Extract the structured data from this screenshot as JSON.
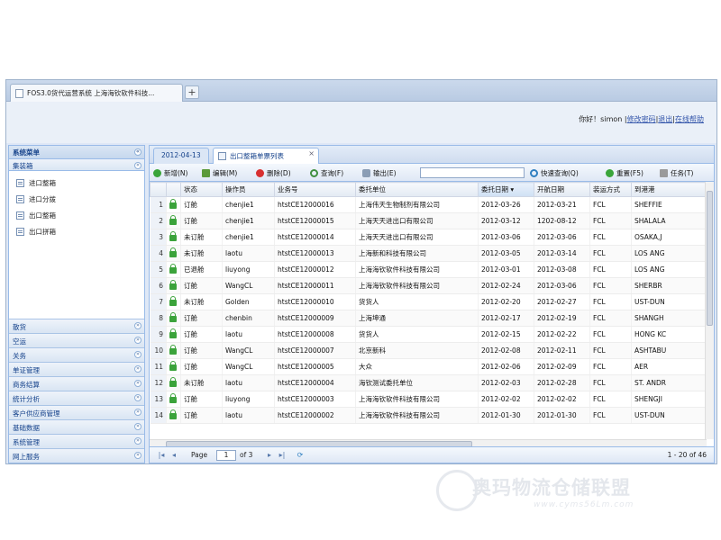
{
  "browser_tab": {
    "title": "FOS3.0货代运营系统 上海海钦软件科技...",
    "add_label": "+"
  },
  "header": {
    "greeting": "你好！simon",
    "link_password": "修改密码",
    "link_logout": "退出",
    "link_help": "在线帮助",
    "separator": "|"
  },
  "sidebar": {
    "title": "系统菜单",
    "section": "集装箱",
    "items": [
      "进口整箱",
      "进口分拨",
      "出口整箱",
      "出口拼箱"
    ],
    "groups": [
      "散货",
      "空运",
      "关务",
      "单证管理",
      "商务结算",
      "统计分析",
      "客户供应商管理",
      "基础数据",
      "系统管理",
      "网上服务"
    ]
  },
  "page_tabs": [
    {
      "label": "2012-04-13"
    },
    {
      "label": "出口整箱单票列表"
    }
  ],
  "toolbar": {
    "add": "新增(N)",
    "edit": "编辑(M)",
    "delete": "删除(D)",
    "query": "查询(F)",
    "export": "输出(E)",
    "search_value": "",
    "quick_query": "快速查询(Q)",
    "reset": "重置(F5)",
    "task": "任务(T)"
  },
  "grid": {
    "columns": [
      "",
      "",
      "状态",
      "操作员",
      "业务号",
      "委托单位",
      "委托日期",
      "开航日期",
      "装运方式",
      "到港港"
    ],
    "sorted_column": "委托日期",
    "rows": [
      {
        "n": "1",
        "status": "订舱",
        "op": "chenjie1",
        "no": "htstCE12000016",
        "client": "上海伟天生物制剂有限公司",
        "entrust": "2012-03-26",
        "sail": "2012-03-21",
        "mode": "FCL",
        "port": "SHEFFIE"
      },
      {
        "n": "2",
        "status": "订舱",
        "op": "chenjie1",
        "no": "htstCE12000015",
        "client": "上海天天进出口有限公司",
        "entrust": "2012-03-12",
        "sail": "1202-08-12",
        "mode": "FCL",
        "port": "SHALALA"
      },
      {
        "n": "3",
        "status": "未订舱",
        "op": "chenjie1",
        "no": "htstCE12000014",
        "client": "上海天天进出口有限公司",
        "entrust": "2012-03-06",
        "sail": "2012-03-06",
        "mode": "FCL",
        "port": "OSAKA,J"
      },
      {
        "n": "4",
        "status": "未订舱",
        "op": "laotu",
        "no": "htstCE12000013",
        "client": "上海新和科技有限公司",
        "entrust": "2012-03-05",
        "sail": "2012-03-14",
        "mode": "FCL",
        "port": "LOS ANG"
      },
      {
        "n": "5",
        "status": "已退舱",
        "op": "liuyong",
        "no": "htstCE12000012",
        "client": "上海海钦软件科技有限公司",
        "entrust": "2012-03-01",
        "sail": "2012-03-08",
        "mode": "FCL",
        "port": "LOS ANG"
      },
      {
        "n": "6",
        "status": "订舱",
        "op": "WangCL",
        "no": "htstCE12000011",
        "client": "上海海钦软件科技有限公司",
        "entrust": "2012-02-24",
        "sail": "2012-03-06",
        "mode": "FCL",
        "port": "SHERBR"
      },
      {
        "n": "7",
        "status": "未订舱",
        "op": "Golden",
        "no": "htstCE12000010",
        "client": "货货人",
        "entrust": "2012-02-20",
        "sail": "2012-02-27",
        "mode": "FCL",
        "port": "UST-DUN"
      },
      {
        "n": "8",
        "status": "订舱",
        "op": "chenbin",
        "no": "htstCE12000009",
        "client": "上海坤通",
        "entrust": "2012-02-17",
        "sail": "2012-02-19",
        "mode": "FCL",
        "port": "SHANGH"
      },
      {
        "n": "9",
        "status": "订舱",
        "op": "laotu",
        "no": "htstCE12000008",
        "client": "货货人",
        "entrust": "2012-02-15",
        "sail": "2012-02-22",
        "mode": "FCL",
        "port": "HONG KC"
      },
      {
        "n": "10",
        "status": "订舱",
        "op": "WangCL",
        "no": "htstCE12000007",
        "client": "北京新科",
        "entrust": "2012-02-08",
        "sail": "2012-02-11",
        "mode": "FCL",
        "port": "ASHTABU"
      },
      {
        "n": "11",
        "status": "订舱",
        "op": "WangCL",
        "no": "htstCE12000005",
        "client": "大众",
        "entrust": "2012-02-06",
        "sail": "2012-02-09",
        "mode": "FCL",
        "port": "AER"
      },
      {
        "n": "12",
        "status": "未订舱",
        "op": "laotu",
        "no": "htstCE12000004",
        "client": "海钦测试委托单位",
        "entrust": "2012-02-03",
        "sail": "2012-02-28",
        "mode": "FCL",
        "port": "ST. ANDR"
      },
      {
        "n": "13",
        "status": "订舱",
        "op": "liuyong",
        "no": "htstCE12000003",
        "client": "上海海钦软件科技有限公司",
        "entrust": "2012-02-02",
        "sail": "2012-02-02",
        "mode": "FCL",
        "port": "SHENGJI"
      },
      {
        "n": "14",
        "status": "订舱",
        "op": "laotu",
        "no": "htstCE12000002",
        "client": "上海海钦软件科技有限公司",
        "entrust": "2012-01-30",
        "sail": "2012-01-30",
        "mode": "FCL",
        "port": "UST-DUN"
      }
    ]
  },
  "pager": {
    "page_label": "Page",
    "page": "1",
    "of_label": "of 3",
    "summary": "1 - 20 of 46"
  },
  "watermark": {
    "text": "奥玛物流仓储联盟",
    "url": "www.cyms56Lm.com"
  },
  "colors": {
    "accent": "#15428b",
    "panel_border": "#99bbe8",
    "lock": "#3ba33b"
  }
}
